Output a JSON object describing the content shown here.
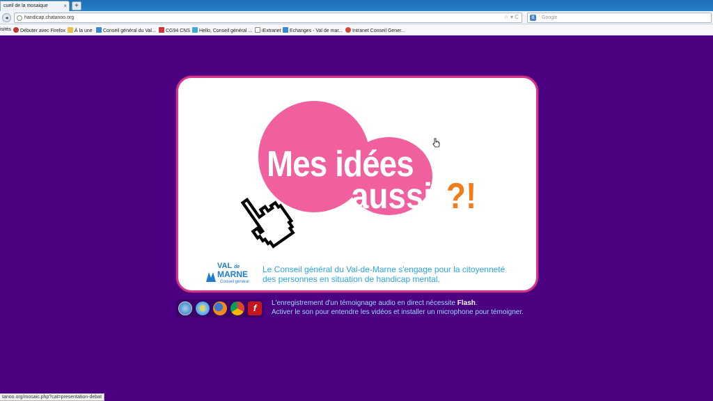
{
  "browser": {
    "tab_title": "cueil de la mosaique",
    "tab_close": "×",
    "new_tab": "+",
    "url": "handicap.chatanoo.org",
    "url_controls": "☆ ▾ C",
    "search_placeholder": "Google",
    "search_engine": "8"
  },
  "bookmarks": [
    {
      "label": "isités",
      "icon": "none"
    },
    {
      "label": "Débuter avec Firefox",
      "icon": "firefox-icon"
    },
    {
      "label": "À la une",
      "icon": "folder-icon"
    },
    {
      "label": "Conseil général du Val...",
      "icon": "cg94-icon"
    },
    {
      "label": "CG94 CNS",
      "icon": "cg94-red-icon"
    },
    {
      "label": "Hello, Conseil général ...",
      "icon": "hello-icon"
    },
    {
      "label": "iExtranet",
      "icon": "page-icon"
    },
    {
      "label": "Echanges - Val de mar...",
      "icon": "cg94-icon"
    },
    {
      "label": "Intranet Conseil Gener...",
      "icon": "intranet-icon"
    }
  ],
  "page": {
    "headline_line1": "Mes idées",
    "headline_line2": "aussi",
    "headline_mark": "?!",
    "logo": {
      "top": "VAL",
      "de": "de",
      "mid": "MARNE",
      "sub": "Conseil général"
    },
    "description": "Le Conseil général du Val-de-Marne s'engage pour la citoyenneté des personnes en situation de handicap mental.",
    "flash_note_line1_pre": "L'enregistrement d'un témoignage audio en direct nécessite ",
    "flash_note_line1_bold": "Flash",
    "flash_note_line1_post": ".",
    "flash_note_line2": "Activer le son pour entendre les vidéos et installer un microphone pour témoigner.",
    "browser_icons": [
      "safari-icon",
      "internet-explorer-icon",
      "firefox-icon",
      "chrome-icon",
      "flash-icon"
    ]
  },
  "status_bar": "tanoo.org/mosaic.php?cat=presentation-debat",
  "colors": {
    "page_background": "#4a0080",
    "card_border": "#d4368f",
    "pink": "#f0609f",
    "orange": "#f07d1c",
    "blue_text": "#2aa4e4"
  }
}
